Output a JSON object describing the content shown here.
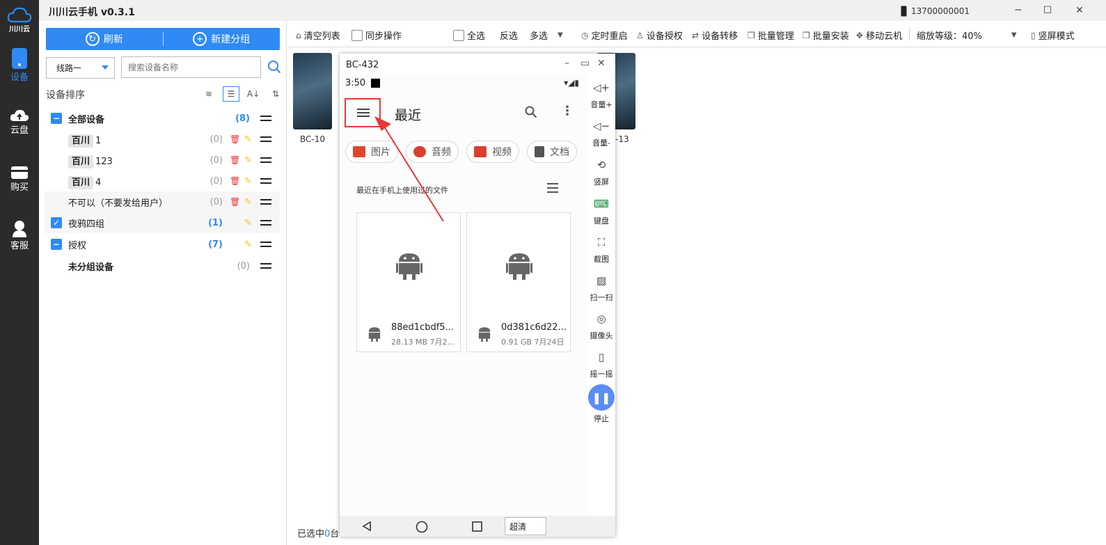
{
  "app": {
    "title": "川川云手机 v0.3.1",
    "account": "13700000001",
    "logo_text": "川川云"
  },
  "nav": [
    {
      "label": "设备",
      "icon": "phone-icon",
      "active": true
    },
    {
      "label": "云盘",
      "icon": "cloud-upload-icon",
      "active": false
    },
    {
      "label": "购买",
      "icon": "card-icon",
      "active": false
    },
    {
      "label": "客服",
      "icon": "service-icon",
      "active": false
    }
  ],
  "sidebar": {
    "refresh": "刷新",
    "new_group": "新建分组",
    "line_select": "线路一",
    "search_placeholder": "搜索设备名称",
    "sort_title": "设备排序",
    "groups": [
      {
        "tag": "",
        "name": "全部设备",
        "count": "(8)"
      },
      {
        "tag": "百川",
        "name": "1",
        "count": "(0)"
      },
      {
        "tag": "百川",
        "name": "123",
        "count": "(0)"
      },
      {
        "tag": "百川",
        "name": "4",
        "count": "(0)"
      },
      {
        "tag": "",
        "name": "不可以（不要发给用户）",
        "count": "(0)"
      },
      {
        "tag": "",
        "name": "夜鸦四组",
        "count": "(1)"
      },
      {
        "tag": "",
        "name": "授权",
        "count": "(7)"
      },
      {
        "tag": "",
        "name": "未分组设备",
        "count": "(0)"
      }
    ]
  },
  "toolbar": {
    "clear_list": "清空列表",
    "sync_op": "同步操作",
    "select_all": "全选",
    "invert": "反选",
    "multi": "多选",
    "scheduled_restart": "定时重启",
    "device_auth": "设备授权",
    "device_transfer": "设备转移",
    "batch_manage": "批量管理",
    "batch_install": "批量安装",
    "move_cloud": "移动云机",
    "zoom": "缩放等级：40%",
    "portrait_mode": "竖屏模式"
  },
  "devices": [
    {
      "label": "BC-10"
    },
    {
      "label": "-13"
    }
  ],
  "status": {
    "prefix": "已选中",
    "count": "0",
    "suffix": "台"
  },
  "phone": {
    "title": "BC-432",
    "time": "3:50",
    "header": "最近",
    "chips": [
      {
        "label": "图片",
        "color": "#e0452c"
      },
      {
        "label": "音频",
        "color": "#d9402e"
      },
      {
        "label": "视频",
        "color": "#d9402e"
      },
      {
        "label": "文档",
        "color": "#555555"
      }
    ],
    "files_heading": "最近在手机上使用过的文件",
    "files": [
      {
        "name": "88ed1cbdf5...",
        "meta": "28.13 MB 7月2..."
      },
      {
        "name": "0d381c6d22...",
        "meta": "0.91 GB 7月24日"
      }
    ],
    "quality": "超清"
  },
  "sidepanel": [
    "音量+",
    "音量-",
    "竖屏",
    "键盘",
    "截图",
    "扫一扫",
    "摄像头",
    "摇一摇",
    "停止"
  ],
  "colors": {
    "accent": "#2f8af5",
    "nav_bg": "#2b2b2b",
    "highlight_box": "#e53935"
  }
}
